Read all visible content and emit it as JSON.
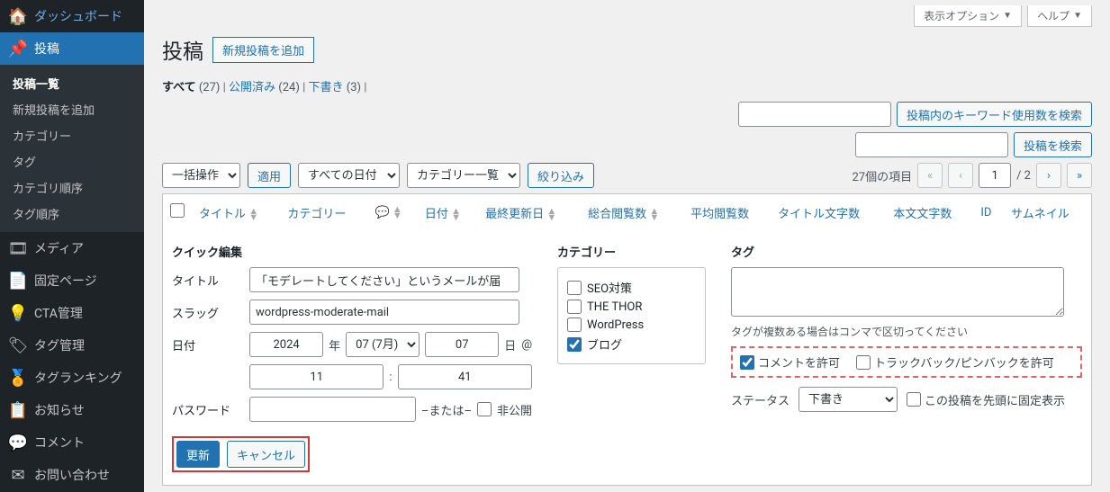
{
  "sidebar": {
    "dashboard": "ダッシュボード",
    "posts": "投稿",
    "submenu": {
      "list": "投稿一覧",
      "new": "新規投稿を追加",
      "cat": "カテゴリー",
      "tag": "タグ",
      "catorder": "カテゴリ順序",
      "tagorder": "タグ順序"
    },
    "media": "メディア",
    "pages": "固定ページ",
    "cta": "CTA管理",
    "tagmgr": "タグ管理",
    "tagrank": "タグランキング",
    "notice": "お知らせ",
    "comments": "コメント",
    "contact": "お問い合わせ"
  },
  "screen": {
    "options": "表示オプション",
    "help": "ヘルプ"
  },
  "heading": {
    "title": "投稿",
    "add_new": "新規投稿を追加"
  },
  "views": {
    "all_label": "すべて",
    "all_count": "(27)",
    "pub_label": "公開済み",
    "pub_count": "(24)",
    "draft_label": "下書き",
    "draft_count": "(3)"
  },
  "search": {
    "keyword_btn": "投稿内のキーワード使用数を検索",
    "search_btn": "投稿を検索"
  },
  "filters": {
    "bulk": "一括操作",
    "apply": "適用",
    "dates": "すべての日付",
    "cats": "カテゴリー一覧",
    "filter": "絞り込み"
  },
  "pagination": {
    "items": "27個の項目",
    "page": "1",
    "total": "/ 2"
  },
  "columns": {
    "title": "タイトル",
    "category": "カテゴリー",
    "date": "日付",
    "lastmod": "最終更新日",
    "totalviews": "総合閲覧数",
    "avgviews": "平均閲覧数",
    "titlechars": "タイトル文字数",
    "bodychars": "本文文字数",
    "id": "ID",
    "thumb": "サムネイル"
  },
  "qe": {
    "heading": "クイック編集",
    "title_label": "タイトル",
    "title_value": "「モデレートしてください」というメールが届",
    "slug_label": "スラッグ",
    "slug_value": "wordpress-moderate-mail",
    "date_label": "日付",
    "year": "2024",
    "year_suffix": "年",
    "month": "07 (7月)",
    "day": "07",
    "day_suffix": "日",
    "at": "@",
    "hour": "11",
    "minute": "41",
    "password_label": "パスワード",
    "or": "–または–",
    "private": "非公開",
    "cat_heading": "カテゴリー",
    "cats": {
      "seo": "SEO対策",
      "thor": "THE THOR",
      "wp": "WordPress",
      "blog": "ブログ"
    },
    "tag_heading": "タグ",
    "tag_hint": "タグが複数ある場合はコンマで区切ってください",
    "allow_comments": "コメントを許可",
    "allow_pings": "トラックバック/ピンバックを許可",
    "status_label": "ステータス",
    "status_value": "下書き",
    "sticky": "この投稿を先頭に固定表示",
    "update": "更新",
    "cancel": "キャンセル"
  }
}
